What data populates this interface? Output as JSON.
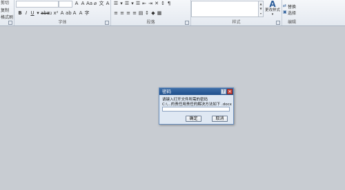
{
  "ribbon": {
    "clipboard": {
      "items": [
        "复制",
        "格式刷"
      ],
      "partial": "剪切"
    },
    "groups": {
      "font": "字体",
      "paragraph": "段落",
      "styles": "样式",
      "editing": "编辑"
    },
    "styles_button": "更改样式",
    "editing": {
      "replace": "替换",
      "select": "选择"
    }
  },
  "dialog": {
    "title": "密码",
    "prompt_line1": "请键入打开文件所需的密码",
    "prompt_line2": "C:\\...的责任用责任的解决方法如下 .docx",
    "password_value": "",
    "ok": "确定",
    "cancel": "取消"
  },
  "colors": {
    "desktop": "#c8ccd2",
    "dialog_title": "#2a5c99",
    "dialog_body": "#dfe8f3"
  }
}
